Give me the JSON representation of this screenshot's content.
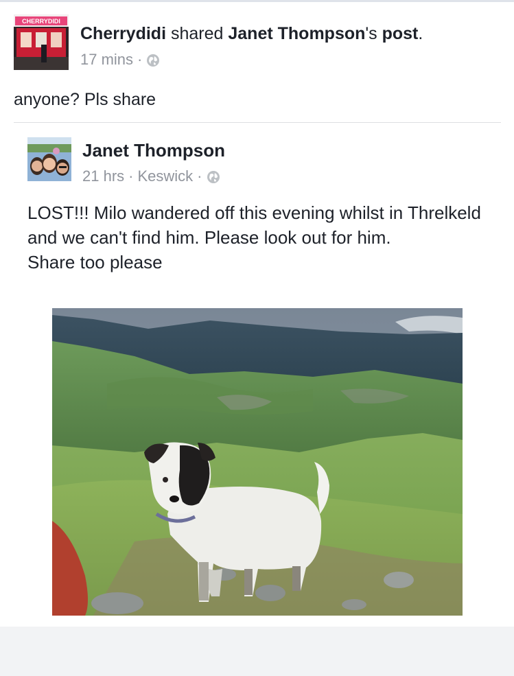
{
  "shared_post": {
    "sharer_name": "Cherrydidi",
    "shared_word": " shared ",
    "original_author": "Janet Thompson",
    "possessive": "'s ",
    "post_word": "post",
    "period": ".",
    "time": "17 mins",
    "separator": "·",
    "audience_icon": "globe-icon",
    "avatar_sign_text": "CHERRYDIDI",
    "text": "anyone? Pls share"
  },
  "original_post": {
    "author": "Janet Thompson",
    "time": "21 hrs",
    "separator": "·",
    "location": "Keswick",
    "audience_icon": "globe-icon",
    "body_line1": "LOST!!! Milo wandered off this evening whilst in Threlkeld and we can't find him. Please look out for him.",
    "body_line2": "Share too please"
  },
  "colors": {
    "text": "#1d2129",
    "meta": "#90949c",
    "divider": "#dddfe2",
    "footer_bg": "#f2f3f5"
  }
}
